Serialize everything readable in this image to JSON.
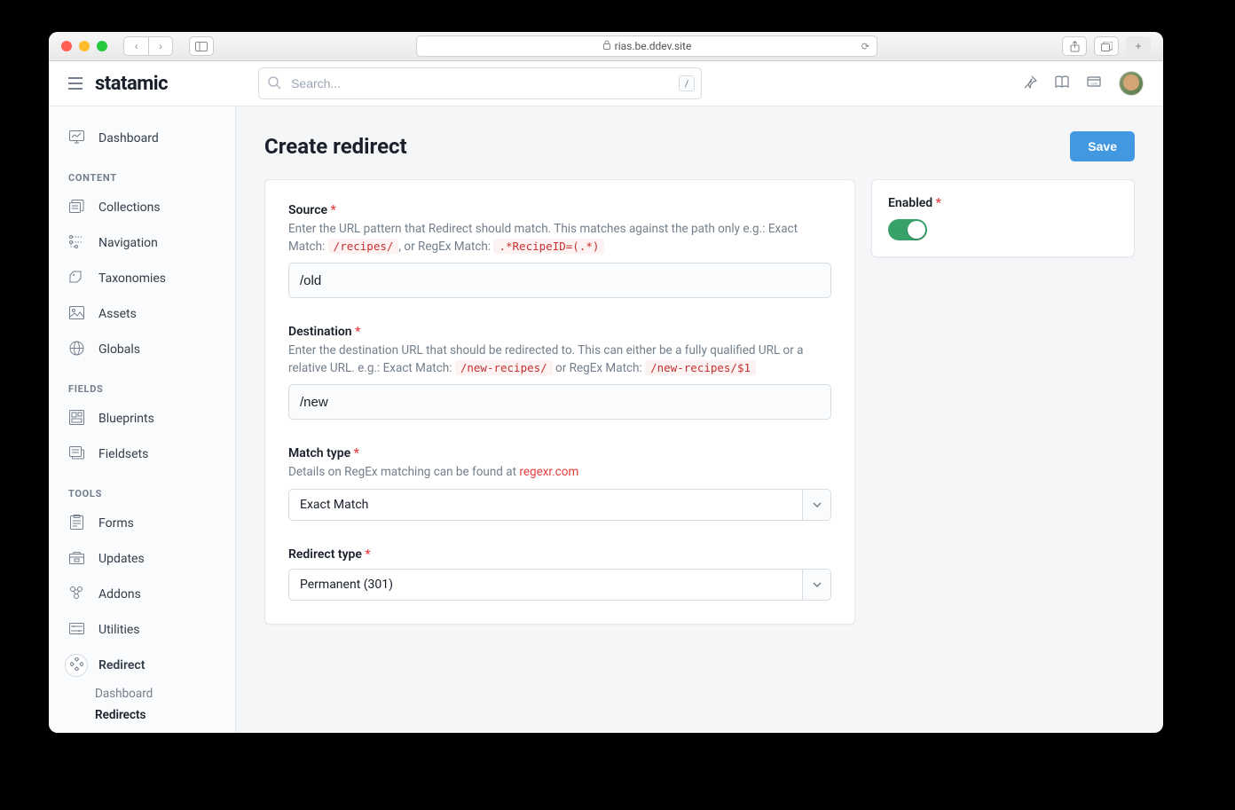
{
  "browser": {
    "url": "rias.be.ddev.site"
  },
  "header": {
    "logo": "statamic",
    "search_placeholder": "Search...",
    "search_kbd": "/"
  },
  "sidebar": {
    "items": [
      {
        "label": "Dashboard"
      }
    ],
    "groups": [
      {
        "heading": "CONTENT",
        "items": [
          {
            "label": "Collections"
          },
          {
            "label": "Navigation"
          },
          {
            "label": "Taxonomies"
          },
          {
            "label": "Assets"
          },
          {
            "label": "Globals"
          }
        ]
      },
      {
        "heading": "FIELDS",
        "items": [
          {
            "label": "Blueprints"
          },
          {
            "label": "Fieldsets"
          }
        ]
      },
      {
        "heading": "TOOLS",
        "items": [
          {
            "label": "Forms"
          },
          {
            "label": "Updates"
          },
          {
            "label": "Addons"
          },
          {
            "label": "Utilities"
          },
          {
            "label": "Redirect",
            "active": true,
            "children": [
              {
                "label": "Dashboard"
              },
              {
                "label": "Redirects",
                "bold": true
              }
            ]
          }
        ]
      }
    ]
  },
  "page": {
    "title": "Create redirect",
    "save_label": "Save"
  },
  "fields": {
    "source": {
      "label": "Source",
      "help_a": "Enter the URL pattern that Redirect should match. This matches against the path only e.g.: Exact Match: ",
      "code_a": "/recipes/",
      "help_b": ", or RegEx Match: ",
      "code_b": ".*RecipeID=(.*)",
      "value": "/old"
    },
    "destination": {
      "label": "Destination",
      "help_a": "Enter the destination URL that should be redirected to. This can either be a fully qualified URL or a relative URL. e.g.: Exact Match: ",
      "code_a": "/new-recipes/",
      "help_b": " or RegEx Match: ",
      "code_b": "/new-recipes/$1",
      "value": "/new"
    },
    "match_type": {
      "label": "Match type",
      "help_a": "Details on RegEx matching can be found at ",
      "link": "regexr.com",
      "value": "Exact Match"
    },
    "redirect_type": {
      "label": "Redirect type",
      "value": "Permanent (301)"
    },
    "enabled": {
      "label": "Enabled"
    }
  }
}
